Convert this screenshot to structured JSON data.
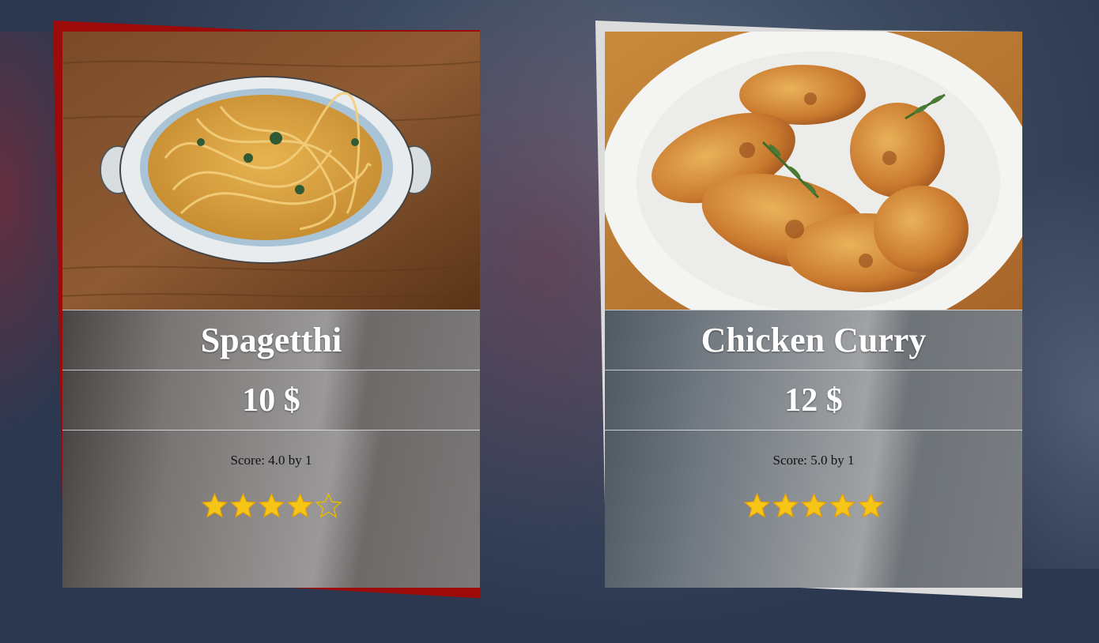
{
  "colors": {
    "left_frame": "#9c0a0a",
    "right_frame": "#dcdcdc",
    "star_fill": "#f5c518",
    "star_outline": "#e8b800"
  },
  "dishes": [
    {
      "name": "Spagetthi",
      "price": "10 $",
      "score_text": "Score: 4.0 by 1",
      "rating": 4,
      "max_rating": 5,
      "image_icon": "spaghetti-bowl-photo"
    },
    {
      "name": "Chicken Curry",
      "price": "12 $",
      "score_text": "Score: 5.0 by 1",
      "rating": 5,
      "max_rating": 5,
      "image_icon": "chicken-plate-photo"
    }
  ]
}
